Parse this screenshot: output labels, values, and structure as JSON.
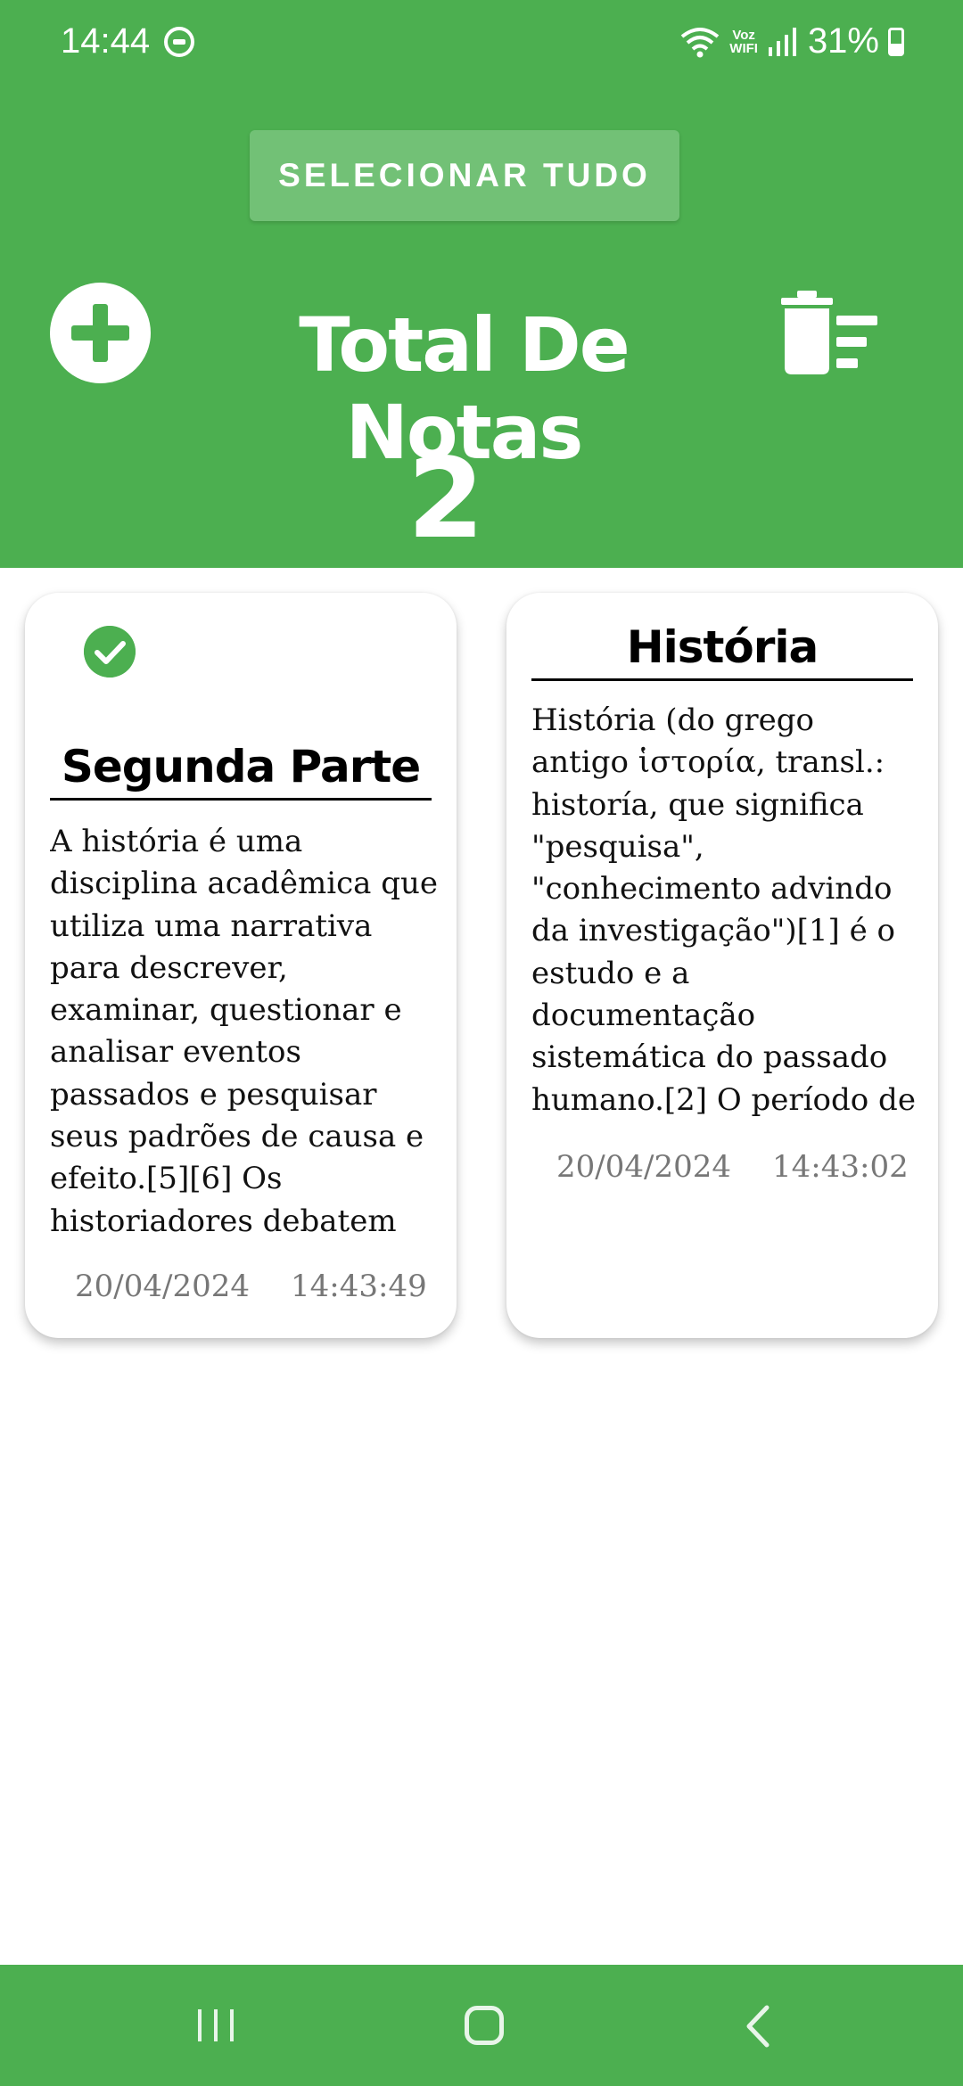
{
  "status_bar": {
    "time": "14:44",
    "voz_label": "Voz",
    "wifi_label": "WIFI",
    "battery": "31%"
  },
  "header": {
    "select_all_label": "SELECIONAR TUDO",
    "total_title": "Total De Notas",
    "total_count": "2"
  },
  "notes": [
    {
      "selected": true,
      "title": "Segunda Parte",
      "body": "A história é uma disciplina acadêmica que utiliza uma narrativa para descrever, examinar, questionar e analisar eventos passados e pesquisar seus padrões de causa e efeito.[5][6] Os historiadores debatem qual narrativa explica m...",
      "date": "20/04/2024",
      "time": "14:43:49"
    },
    {
      "selected": false,
      "title": "História",
      "body": "História (do grego antigo ἱστορία, transl.: historía, que significa \"pesquisa\", \"conhecimento advindo da investigação\")[1] é o estudo e a documentação sistemática do passado humano.[2] O período de acontecimentos anteriores à invenção do...",
      "date": "20/04/2024",
      "time": "14:43:02"
    }
  ],
  "colors": {
    "accent": "#4caf50",
    "button_light": "#72c176",
    "muted_text": "#777777"
  },
  "icons": [
    "add-icon",
    "delete-all-icon",
    "check-circle-icon",
    "recent-apps-icon",
    "home-icon",
    "back-icon"
  ]
}
